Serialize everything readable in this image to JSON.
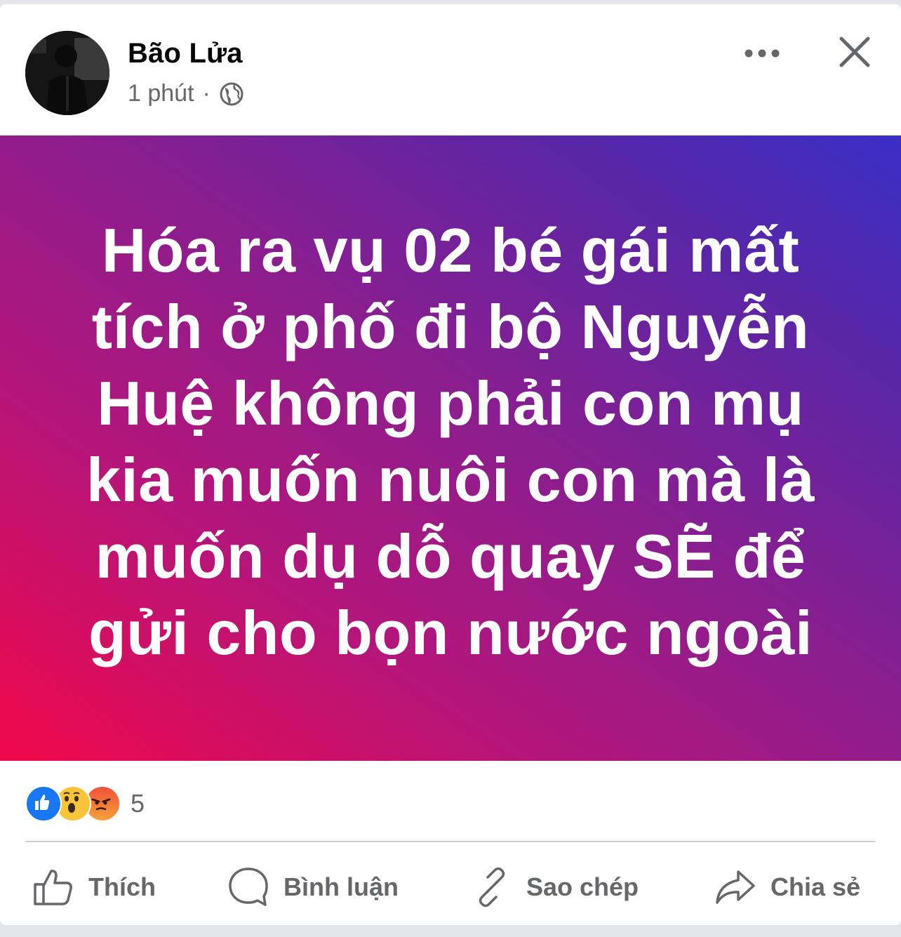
{
  "post": {
    "author": "Bão Lửa",
    "time": "1 phút",
    "separator": "·",
    "audience_icon": "globe-icon",
    "more_icon": "more-dots-icon",
    "close_icon": "close-icon",
    "text": "Hóa ra vụ 02 bé gái mất tích ở phố đi bộ Nguyễn Huệ không phải con mụ kia muốn nuôi con mà là muốn dụ dỗ quay SẼ để gửi cho bọn nước ngoài",
    "background_colors": [
      "#f0084a",
      "#8a1e8f",
      "#3a2fc6"
    ]
  },
  "reactions": {
    "types": [
      "like",
      "wow",
      "angry"
    ],
    "count": "5"
  },
  "actions": {
    "like": "Thích",
    "comment": "Bình luận",
    "copy": "Sao chép",
    "share": "Chia sẻ"
  },
  "colors": {
    "secondary_text": "#65676b",
    "like_blue": "#1877f2",
    "angry_red": "#f0503a",
    "wow_yellow": "#f7c43a"
  }
}
